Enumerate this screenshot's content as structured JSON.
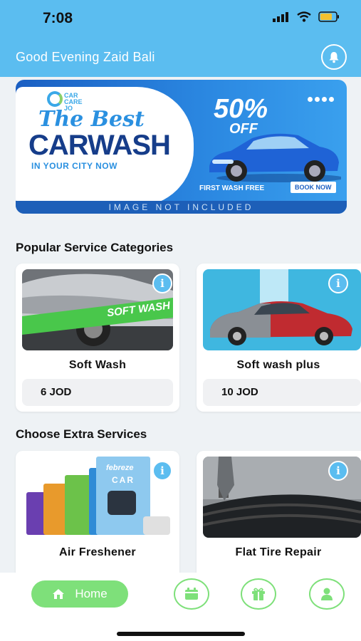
{
  "status_bar": {
    "time": "7:08"
  },
  "header": {
    "greeting": "Good Evening Zaid Bali"
  },
  "banner": {
    "brand": [
      "CAR",
      "CARE",
      "JO"
    ],
    "headline_1": "The Best",
    "headline_2": "CARWASH",
    "headline_3": "IN YOUR CITY NOW",
    "discount": "50%",
    "discount_suffix": "OFF",
    "first_wash": "FIRST WASH FREE",
    "book_now": "BOOK NOW",
    "footer": "IMAGE NOT INCLUDED"
  },
  "popular": {
    "title": "Popular Service Categories",
    "items": [
      {
        "name": "Soft Wash",
        "price": "6 JOD",
        "image_text": "SOFT WASH"
      },
      {
        "name": "Soft wash plus",
        "price": "10 JOD"
      }
    ]
  },
  "extras": {
    "title": "Choose Extra Services",
    "items": [
      {
        "name": "Air Freshener",
        "brand_text": "febreze",
        "product_text": "CAR"
      },
      {
        "name": "Flat Tire Repair"
      }
    ]
  },
  "bottom_nav": {
    "home_label": "Home",
    "icons": [
      "calendar-icon",
      "gift-icon",
      "profile-icon"
    ]
  },
  "colors": {
    "header": "#5bbdf0",
    "nav_accent": "#7ee07a",
    "info_badge": "#5bbdf0"
  }
}
